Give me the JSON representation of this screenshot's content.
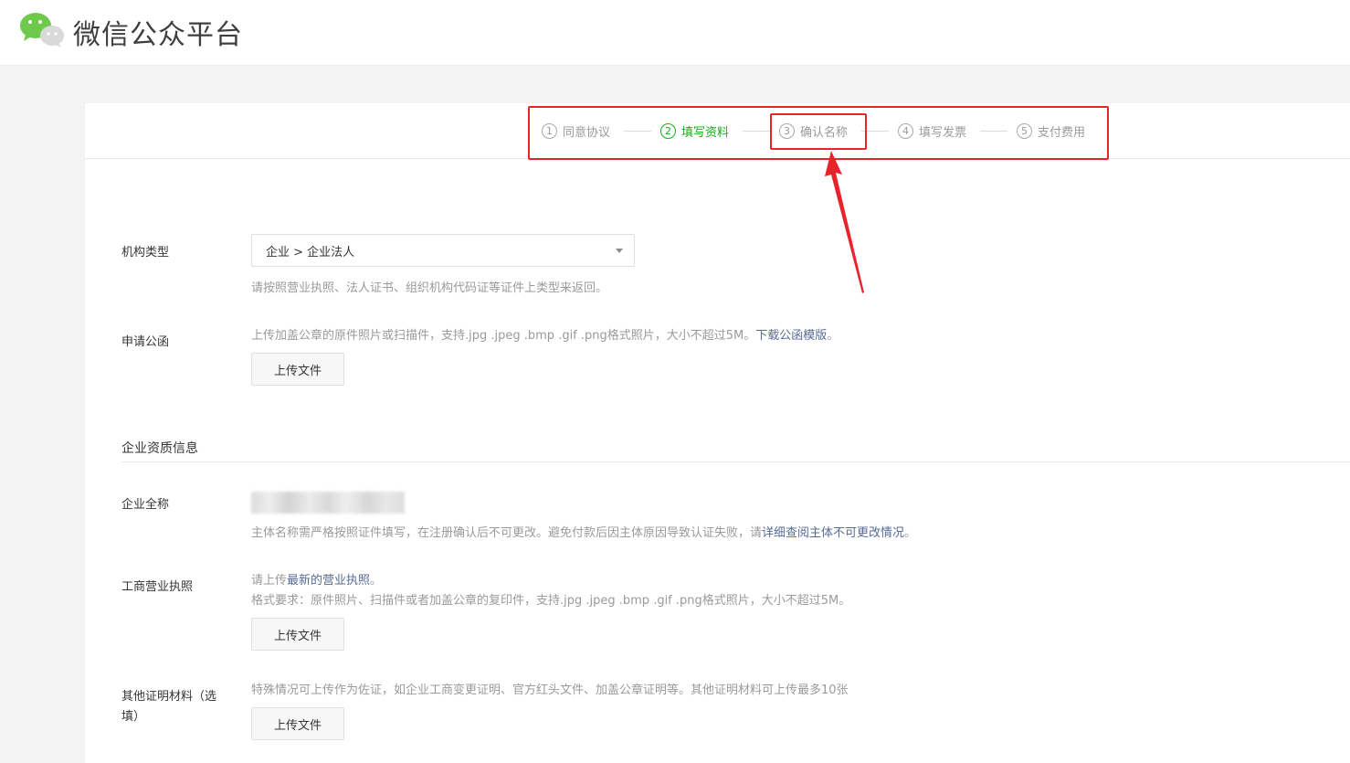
{
  "header": {
    "brand": "微信公众平台",
    "logo_icon": "wechat-logo-icon"
  },
  "steps": [
    {
      "num": "1",
      "label": "同意协议",
      "active": false
    },
    {
      "num": "2",
      "label": "填写资料",
      "active": true
    },
    {
      "num": "3",
      "label": "确认名称",
      "active": false
    },
    {
      "num": "4",
      "label": "填写发票",
      "active": false
    },
    {
      "num": "5",
      "label": "支付费用",
      "active": false
    }
  ],
  "form": {
    "org_type": {
      "label": "机构类型",
      "value": "企业 > 企业法人",
      "hint": "请按照营业执照、法人证书、组织机构代码证等证件上类型来返回。"
    },
    "letter": {
      "label": "申请公函",
      "hint": "上传加盖公章的原件照片或扫描件，支持.jpg .jpeg .bmp .gif .png格式照片，大小不超过5M。",
      "link": "下载公函模版",
      "hint_tail": "。",
      "button": "上传文件"
    },
    "section_title": "企业资质信息",
    "full_name": {
      "label": "企业全称",
      "hint": "主体名称需严格按照证件填写，在注册确认后不可更改。避免付款后因主体原因导致认证失败，请",
      "link": "详细查阅主体不可更改情况",
      "hint_tail": "。"
    },
    "license": {
      "label": "工商营业执照",
      "hint_pre": "请上传",
      "link": "最新的营业执照",
      "hint_tail": "。",
      "hint2": "格式要求：原件照片、扫描件或者加盖公章的复印件，支持.jpg .jpeg .bmp .gif .png格式照片，大小不超过5M。",
      "button": "上传文件"
    },
    "other": {
      "label_line1": "其他证明材料（选",
      "label_line2": "填）",
      "hint": "特殊情况可上传作为佐证，如企业工商变更证明、官方红头文件、加盖公章证明等。其他证明材料可上传最多10张",
      "button": "上传文件"
    }
  },
  "colors": {
    "active_green": "#1aad19",
    "link_blue": "#576b95",
    "annotation_red": "#e9232a"
  }
}
